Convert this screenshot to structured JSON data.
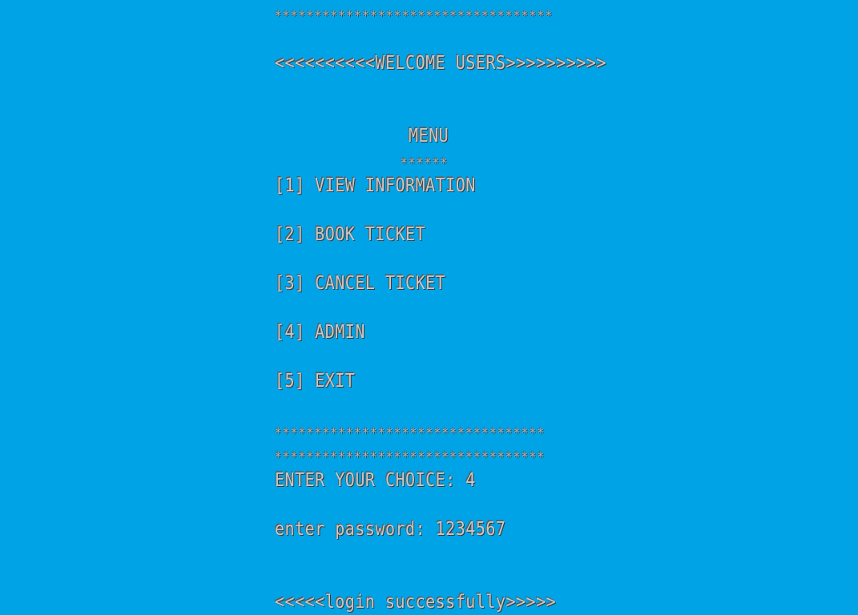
{
  "console": {
    "top_border": "***********************************",
    "welcome": "<<<<<<<<<<WELCOME USERS>>>>>>>>>>",
    "menu_title": "MENU",
    "menu_underline": "******",
    "menu_items": [
      "[1] VIEW INFORMATION",
      "[2] BOOK TICKET",
      "[3] CANCEL TICKET",
      "[4] ADMIN",
      "[5] EXIT"
    ],
    "bottom_border_1": "**********************************",
    "bottom_border_2": "**********************************",
    "choice_prompt": "ENTER YOUR CHOICE: 4",
    "password_prompt": "enter password: 1234567",
    "login_message": "<<<<<login successfully>>>>>"
  }
}
